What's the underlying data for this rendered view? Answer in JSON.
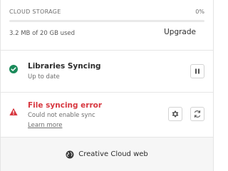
{
  "storage": {
    "title": "CLOUD STORAGE",
    "percent": "0%",
    "used_text": "3.2 MB of 20 GB used",
    "fill_fraction": 0.0,
    "upgrade_label": "Upgrade"
  },
  "sync": {
    "title": "Libraries Syncing",
    "subtitle": "Up to date",
    "status_icon": "check-circle-icon",
    "action_icon": "pause-icon"
  },
  "error": {
    "title": "File syncing error",
    "subtitle": "Could not enable sync",
    "link_label": "Learn more",
    "status_icon": "warning-icon",
    "actions": [
      "gear-icon",
      "refresh-icon"
    ]
  },
  "footer": {
    "label": "Creative Cloud web",
    "icon": "globe-icon"
  },
  "colors": {
    "success": "#1a8a5a",
    "error": "#d7373f",
    "accent": "#2d7be5"
  }
}
